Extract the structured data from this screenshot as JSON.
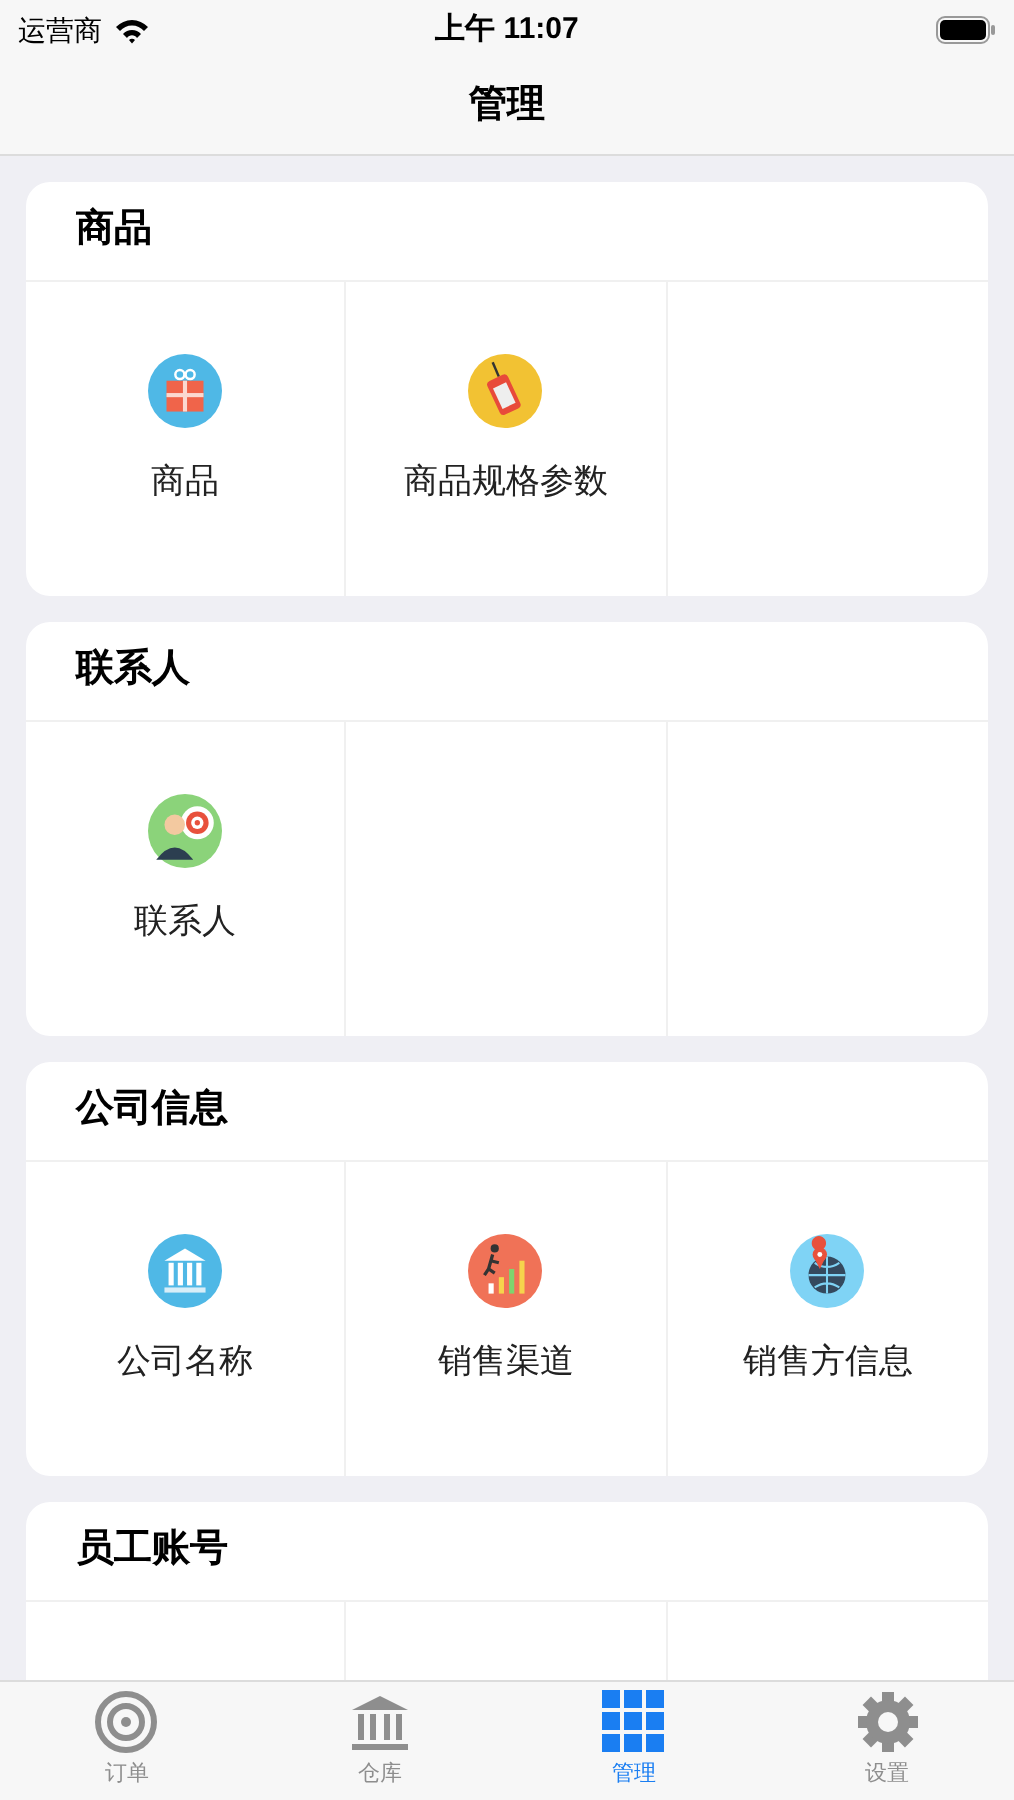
{
  "status_bar": {
    "carrier": "运营商",
    "time": "上午 11:07"
  },
  "nav_bar": {
    "title": "管理"
  },
  "sections": [
    {
      "title": "商品",
      "items": [
        {
          "label": "商品",
          "kind": "gift"
        },
        {
          "label": "商品规格参数",
          "kind": "tag"
        }
      ]
    },
    {
      "title": "联系人",
      "items": [
        {
          "label": "联系人",
          "kind": "contact"
        }
      ]
    },
    {
      "title": "公司信息",
      "items": [
        {
          "label": "公司名称",
          "kind": "bank"
        },
        {
          "label": "销售渠道",
          "kind": "chart"
        },
        {
          "label": "销售方信息",
          "kind": "globe"
        }
      ]
    },
    {
      "title": "员工账号"
    }
  ],
  "tab_bar": [
    {
      "label": "订单",
      "kind": "target",
      "selected": false
    },
    {
      "label": "仓库",
      "kind": "bank",
      "selected": false
    },
    {
      "label": "管理",
      "kind": "grid",
      "selected": true
    },
    {
      "label": "设置",
      "kind": "gear",
      "selected": false
    }
  ]
}
